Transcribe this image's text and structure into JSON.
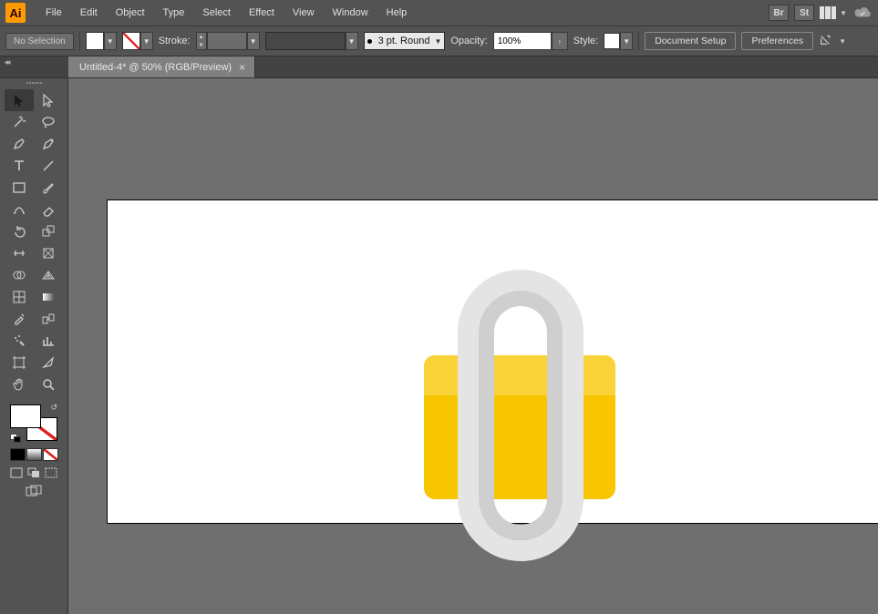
{
  "menu": {
    "items": [
      "File",
      "Edit",
      "Object",
      "Type",
      "Select",
      "Effect",
      "View",
      "Window",
      "Help"
    ],
    "logo": "Ai",
    "br": "Br",
    "st": "St"
  },
  "options": {
    "selection": "No Selection",
    "stroke_label": "Stroke:",
    "brush_label": "3 pt. Round",
    "opacity_label": "Opacity:",
    "opacity_value": "100%",
    "style_label": "Style:",
    "doc_setup": "Document Setup",
    "preferences": "Preferences"
  },
  "tab": {
    "title": "Untitled-4* @ 50% (RGB/Preview)"
  },
  "tools": {
    "row_names": [
      [
        "selection-tool",
        "direct-selection-tool"
      ],
      [
        "magic-wand-tool",
        "lasso-tool"
      ],
      [
        "pen-tool",
        "curvature-tool"
      ],
      [
        "type-tool",
        "line-tool"
      ],
      [
        "rectangle-tool",
        "paintbrush-tool"
      ],
      [
        "shaper-tool",
        "eraser-tool"
      ],
      [
        "rotate-tool",
        "scale-tool"
      ],
      [
        "width-tool",
        "free-transform-tool"
      ],
      [
        "shape-builder-tool",
        "perspective-grid-tool"
      ],
      [
        "mesh-tool",
        "gradient-tool"
      ],
      [
        "eyedropper-tool",
        "blend-tool"
      ],
      [
        "symbol-sprayer-tool",
        "column-graph-tool"
      ],
      [
        "artboard-tool",
        "slice-tool"
      ],
      [
        "hand-tool",
        "zoom-tool"
      ]
    ]
  }
}
